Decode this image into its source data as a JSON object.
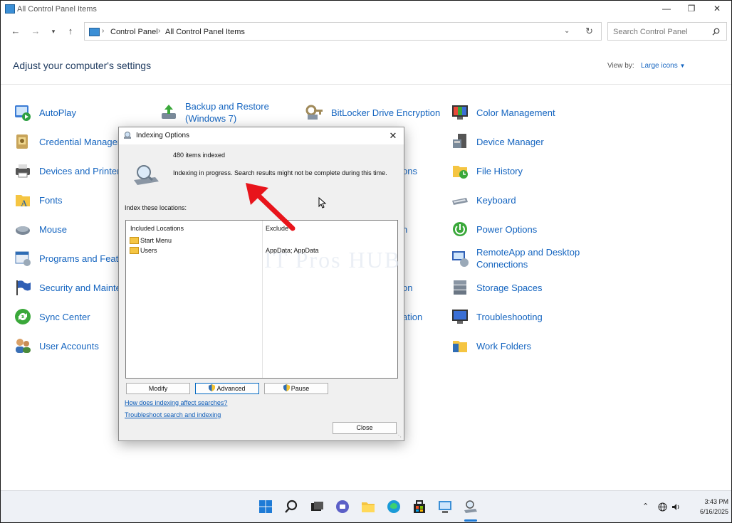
{
  "window": {
    "title": "All Control Panel Items"
  },
  "nav": {
    "breadcrumb": [
      "Control Panel",
      "All Control Panel Items"
    ],
    "search_placeholder": "Search Control Panel"
  },
  "content": {
    "heading": "Adjust your computer's settings",
    "view_by_label": "View by:",
    "view_by_value": "Large icons",
    "items": [
      {
        "label": "AutoPlay",
        "icon": "autoplay-icon"
      },
      {
        "label": "Backup and Restore\n(Windows 7)",
        "icon": "backup-icon"
      },
      {
        "label": "BitLocker Drive Encryption",
        "icon": "bitlocker-icon"
      },
      {
        "label": "Color Management",
        "icon": "color-management-icon"
      },
      {
        "label": "Credential Manager",
        "icon": "credential-icon"
      },
      {
        "label": "Device Manager",
        "icon": "device-manager-icon"
      },
      {
        "label": "Devices and Printers",
        "icon": "printer-icon"
      },
      {
        "label": "ons",
        "icon": ""
      },
      {
        "label": "File History",
        "icon": "file-history-icon"
      },
      {
        "label": "Fonts",
        "icon": "fonts-icon"
      },
      {
        "label": "Keyboard",
        "icon": "keyboard-icon"
      },
      {
        "label": "Mouse",
        "icon": "mouse-icon"
      },
      {
        "label": "n",
        "icon": ""
      },
      {
        "label": "Power Options",
        "icon": "power-icon"
      },
      {
        "label": "Programs and Featu",
        "icon": "programs-icon"
      },
      {
        "label": "RemoteApp and Desktop\nConnections",
        "icon": "remoteapp-icon"
      },
      {
        "label": "Security and Mainte",
        "icon": "security-flag-icon"
      },
      {
        "label": "on",
        "icon": ""
      },
      {
        "label": "Storage Spaces",
        "icon": "storage-icon"
      },
      {
        "label": "Sync Center",
        "icon": "sync-icon"
      },
      {
        "label": "ation",
        "icon": ""
      },
      {
        "label": "Troubleshooting",
        "icon": "troubleshooting-icon"
      },
      {
        "label": "User Accounts",
        "icon": "users-icon"
      },
      {
        "label": "Work Folders",
        "icon": "work-folders-icon"
      }
    ]
  },
  "dialog": {
    "title": "Indexing Options",
    "items_indexed": "480 items indexed",
    "status": "Indexing in progress. Search results might not be complete during this time.",
    "index_label": "Index these locations:",
    "col_included": "Included Locations",
    "col_exclude": "Exclude",
    "locations": [
      {
        "name": "Start Menu",
        "exclude": ""
      },
      {
        "name": "Users",
        "exclude": "AppData; AppData"
      }
    ],
    "btn_modify": "Modify",
    "btn_advanced": "Advanced",
    "btn_pause": "Pause",
    "link_affect": "How does indexing affect searches?",
    "link_troubleshoot": "Troubleshoot search and indexing",
    "btn_close": "Close"
  },
  "watermark": "IT Pros HUB",
  "taskbar": {
    "time": "3:43 PM",
    "date": "6/16/2025"
  },
  "colors": {
    "link": "#1565c0",
    "accent": "#0067c0",
    "arrow": "#e8141b"
  }
}
